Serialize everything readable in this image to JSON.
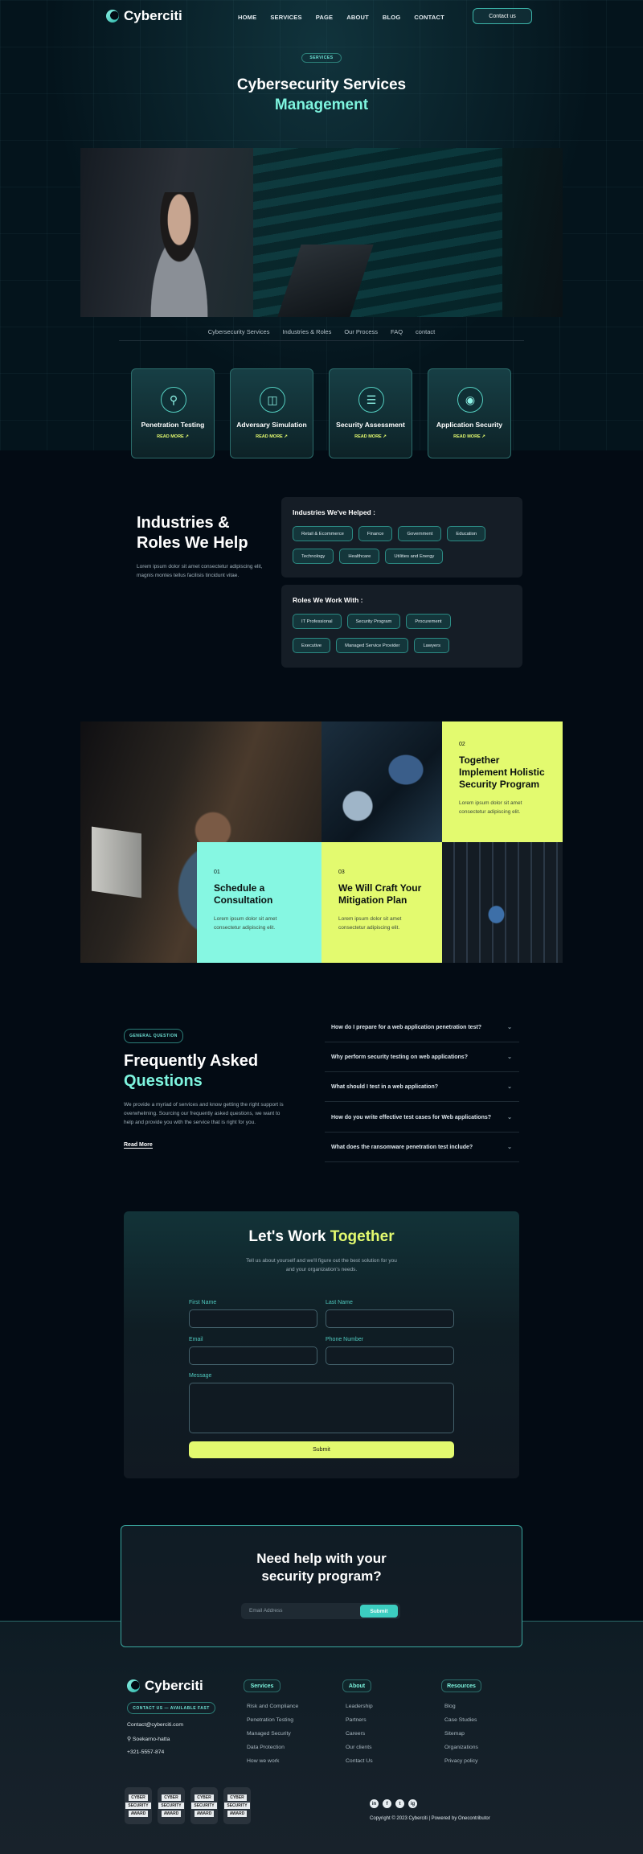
{
  "brand": {
    "name": "Cyberciti"
  },
  "nav": {
    "items": [
      "HOME",
      "SERVICES",
      "PAGE",
      "ABOUT",
      "BLOG",
      "CONTACT"
    ],
    "cta": "Contact us"
  },
  "hero": {
    "tag": "SERVICES",
    "title_line1": "Cybersecurity Services",
    "title_line2": "Management"
  },
  "subnav": [
    "Cybersecurity Services",
    "Industries & Roles",
    "Our Process",
    "FAQ",
    "contact"
  ],
  "services": [
    {
      "name": "Penetration Testing",
      "link": "READ MORE",
      "icon": "search-shield-icon"
    },
    {
      "name": "Adversary Simulation",
      "link": "READ MORE",
      "icon": "monitor-icon"
    },
    {
      "name": "Security Assessment",
      "link": "READ MORE",
      "icon": "clipboard-icon"
    },
    {
      "name": "Application Security",
      "link": "READ MORE",
      "icon": "globe-icon"
    }
  ],
  "industries": {
    "title_line1": "Industries &",
    "title_line2": "Roles We Help",
    "desc": "Lorem ipsum dolor sit amet consectetur adipiscing elit, magnis montes tellus facilisis tincidunt vitae.",
    "helped_title": "Industries We've Helped :",
    "helped_row1": [
      "Retail & Ecommerce",
      "Finance",
      "Government",
      "Education"
    ],
    "helped_row2": [
      "Technology",
      "Healthcare",
      "Utilities and Energy"
    ],
    "roles_title": "Roles We Work With :",
    "roles_row1": [
      "IT Professional",
      "Security Program",
      "Procurement"
    ],
    "roles_row2": [
      "Executive",
      "Managed Service Provider",
      "Lawyers"
    ]
  },
  "process": {
    "step01": {
      "num": "01",
      "title_line1": "Schedule a",
      "title_line2": "Consultation",
      "desc": "Lorem ipsum dolor sit amet consectetur adipiscing elit."
    },
    "step02": {
      "num": "02",
      "title_line1": "Together",
      "title_line2": "Implement Holistic",
      "title_line3": "Security Program",
      "desc": "Lorem ipsum dolor sit amet consectetur adipiscing elit."
    },
    "step03": {
      "num": "03",
      "title_line1": "We Will Craft Your",
      "title_line2": "Mitigation Plan",
      "desc": "Lorem ipsum dolor sit amet consectetur adipiscing elit."
    }
  },
  "faq": {
    "tag": "GENERAL QUESTION",
    "title_line1": "Frequently Asked",
    "title_line2": "Questions",
    "desc": "We provide a myriad of services and know getting the right support is overwhelming. Sourcing our frequently asked questions, we want to help and provide you with the service that is right for you.",
    "read_more": "Read More",
    "items": [
      "How do I prepare for a web application penetration test?",
      "Why perform security testing on web applications?",
      "What should I test in a web application?",
      "How do you write effective test cases for Web applications?",
      "What does the ransomware penetration test include?"
    ]
  },
  "contact_form": {
    "title_a": "Let's Work",
    "title_b": "Together",
    "subtitle_line1": "Tell us about yourself and we'll figure out the best solution for you",
    "subtitle_line2": "and your organization's needs.",
    "first_name": "First Name",
    "last_name": "Last Name",
    "email": "Email",
    "phone": "Phone Number",
    "message": "Message",
    "submit": "Submit"
  },
  "newsletter": {
    "title_line1": "Need help with your",
    "title_line2": "security program?",
    "placeholder": "Email Address",
    "submit": "Submit"
  },
  "footer": {
    "brand": "Cyberciti",
    "availability": "CONTACT US — AVAILABLE FAST",
    "email": "Contact@cyberciti.com",
    "location": "Soekarno-hatta",
    "phone": "+321-5557-874",
    "services_title": "Services",
    "services": [
      "Risk and Compliance",
      "Penetration Testing",
      "Managed Security",
      "Data Protection",
      "How we work"
    ],
    "about_title": "About",
    "about": [
      "Leadership",
      "Partners",
      "Careers",
      "Our clients",
      "Contact Us"
    ],
    "resources_title": "Resources",
    "resources": [
      "Blog",
      "Case Studies",
      "Sitemap",
      "Organizations",
      "Privacy policy"
    ],
    "badges": [
      {
        "line1": "CYBER",
        "line2": "SECURITY",
        "line3": "AWARD"
      },
      {
        "line1": "CYBER",
        "line2": "SECURITY",
        "line3": "AWARD"
      },
      {
        "line1": "CYBER",
        "line2": "SECURITY",
        "line3": "AWARD"
      },
      {
        "line1": "CYBER",
        "line2": "SECURITY",
        "line3": "AWARD"
      }
    ],
    "social": [
      "in",
      "f",
      "t",
      "ig"
    ],
    "copyright": "Copyright © 2023 Cyberciti | Powered by Onecontributor"
  },
  "colors": {
    "accent_teal": "#7ef5df",
    "accent_lime": "#e3fa6f",
    "mint": "#86f7e2",
    "background": "#030b14"
  }
}
